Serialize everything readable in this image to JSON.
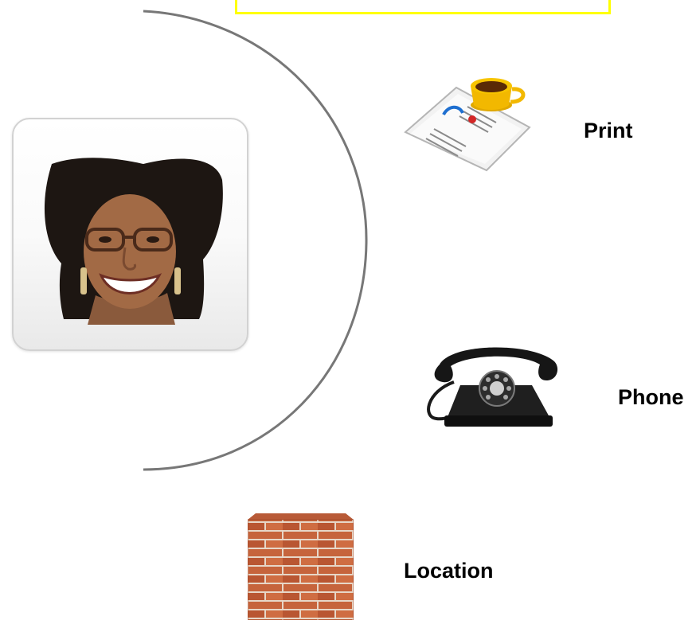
{
  "channels": {
    "print": {
      "label": "Print",
      "icon": "newspaper-coffee-icon"
    },
    "phone": {
      "label": "Phone",
      "icon": "rotary-telephone-icon"
    },
    "location": {
      "label": "Location",
      "icon": "brick-wall-icon"
    }
  },
  "person": {
    "icon": "woman-portrait"
  },
  "colors": {
    "highlight_border": "#ffff00",
    "arc_stroke": "#777777",
    "label_text": "#000000",
    "brick": "#c8643c"
  }
}
